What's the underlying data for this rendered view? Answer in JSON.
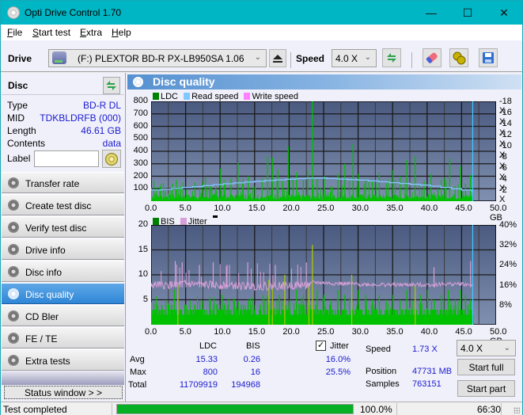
{
  "window": {
    "title": "Opti Drive Control 1.70",
    "controls": {
      "minimize": "—",
      "maximize": "☐",
      "close": "✕"
    }
  },
  "menu": {
    "items": [
      {
        "label": "File",
        "accel": "F",
        "rest": "ile"
      },
      {
        "label": "Start test",
        "accel": "S",
        "rest": "tart test"
      },
      {
        "label": "Extra",
        "accel": "E",
        "rest": "xtra"
      },
      {
        "label": "Help",
        "accel": "H",
        "rest": "elp"
      }
    ]
  },
  "toolbar": {
    "drive_label": "Drive",
    "drive_value": "(F:)  PLEXTOR BD-R  PX-LB950SA 1.06",
    "speed_label": "Speed",
    "speed_value": "4.0 X",
    "icons": [
      "eject-icon",
      "refresh-icon",
      "eraser-icon",
      "options-icon",
      "save-icon"
    ]
  },
  "disc": {
    "header": "Disc",
    "fields": [
      {
        "key": "Type",
        "value": "BD-R DL"
      },
      {
        "key": "MID",
        "value": "TDKBLDRFB (000)"
      },
      {
        "key": "Length",
        "value": "46.61 GB"
      },
      {
        "key": "Contents",
        "value": "data"
      }
    ],
    "label_key": "Label",
    "label_value": ""
  },
  "nav": {
    "items": [
      {
        "label": "Transfer rate",
        "active": false
      },
      {
        "label": "Create test disc",
        "active": false
      },
      {
        "label": "Verify test disc",
        "active": false
      },
      {
        "label": "Drive info",
        "active": false
      },
      {
        "label": "Disc info",
        "active": false
      },
      {
        "label": "Disc quality",
        "active": true
      },
      {
        "label": "CD Bler",
        "active": false
      },
      {
        "label": "FE / TE",
        "active": false
      },
      {
        "label": "Extra tests",
        "active": false
      }
    ],
    "status_window": "Status window > >"
  },
  "panel": {
    "title": "Disc quality"
  },
  "colors": {
    "ldc": "#00c000",
    "bis": "#00c000",
    "read_speed": "#80c8ff",
    "write_speed": "#ff80ff",
    "jitter": "#d8a0d8",
    "legend_ldc": "#008000",
    "legend_bis": "#008000",
    "plot_top": "#4a5a80",
    "plot_bottom": "#8090b0",
    "end_marker": "#40c8ff",
    "progress": "#06b025"
  },
  "chart_data": [
    {
      "type": "bar",
      "title": "LDC / Read speed",
      "legend": [
        "LDC",
        "Read speed",
        "Write speed"
      ],
      "legend_placement": "top-left",
      "xlabel": "GB",
      "x_ticks": [
        "0.0",
        "5.0",
        "10.0",
        "15.0",
        "20.0",
        "25.0",
        "30.0",
        "35.0",
        "40.0",
        "45.0",
        "50.0 GB"
      ],
      "xlim": [
        0,
        50
      ],
      "y_ticks": [
        "800",
        "700",
        "600",
        "500",
        "400",
        "300",
        "200",
        "100"
      ],
      "ylim": [
        0,
        800
      ],
      "y2_ticks": [
        "18 X",
        "16 X",
        "14 X",
        "12 X",
        "10 X",
        "8 X",
        "6 X",
        "4 X",
        "2 X"
      ],
      "y2lim": [
        0,
        18
      ],
      "grid": true,
      "disc_end_gb": 46.61,
      "ldc_spikes": [
        [
          0.5,
          60
        ],
        [
          1.2,
          120
        ],
        [
          2.0,
          80
        ],
        [
          3.0,
          140
        ],
        [
          3.6,
          170
        ],
        [
          4.2,
          110
        ],
        [
          5.0,
          90
        ],
        [
          6.3,
          150
        ],
        [
          7.2,
          70
        ],
        [
          7.8,
          190
        ],
        [
          8.5,
          120
        ],
        [
          9.3,
          110
        ],
        [
          10.0,
          260
        ],
        [
          10.6,
          140
        ],
        [
          11.5,
          180
        ],
        [
          12.5,
          310
        ],
        [
          13.2,
          150
        ],
        [
          14.0,
          200
        ],
        [
          15.0,
          120
        ],
        [
          16.0,
          180
        ],
        [
          16.8,
          360
        ],
        [
          17.5,
          350
        ],
        [
          18.3,
          250
        ],
        [
          19.0,
          160
        ],
        [
          19.8,
          440
        ],
        [
          20.5,
          180
        ],
        [
          21.0,
          230
        ],
        [
          22.0,
          170
        ],
        [
          22.6,
          250
        ],
        [
          23.3,
          800
        ],
        [
          24.0,
          180
        ],
        [
          25.0,
          200
        ],
        [
          26.0,
          120
        ],
        [
          27.0,
          220
        ],
        [
          28.0,
          300
        ],
        [
          29.2,
          460
        ],
        [
          30.0,
          220
        ],
        [
          31.0,
          180
        ],
        [
          32.0,
          160
        ],
        [
          33.0,
          230
        ],
        [
          34.0,
          140
        ],
        [
          35.0,
          250
        ],
        [
          36.0,
          200
        ],
        [
          37.0,
          330
        ],
        [
          38.2,
          360
        ],
        [
          39.5,
          160
        ],
        [
          40.5,
          220
        ],
        [
          41.5,
          100
        ],
        [
          42.5,
          190
        ],
        [
          43.2,
          340
        ],
        [
          44.0,
          120
        ],
        [
          44.8,
          280
        ],
        [
          45.5,
          140
        ],
        [
          46.2,
          210
        ]
      ],
      "ldc_baseline": 30,
      "read_speed": [
        [
          0,
          2.0
        ],
        [
          5,
          2.5
        ],
        [
          10,
          3.1
        ],
        [
          15,
          3.6
        ],
        [
          20,
          4.0
        ],
        [
          23.5,
          4.2
        ],
        [
          25,
          4.1
        ],
        [
          30,
          3.8
        ],
        [
          35,
          3.3
        ],
        [
          40,
          2.8
        ],
        [
          45,
          2.0
        ],
        [
          46.61,
          1.73
        ]
      ]
    },
    {
      "type": "bar",
      "title": "BIS / Jitter",
      "legend": [
        "BIS",
        "Jitter"
      ],
      "legend_placement": "top-left",
      "xlabel": "GB",
      "x_ticks": [
        "0.0",
        "5.0",
        "10.0",
        "15.0",
        "20.0",
        "25.0",
        "30.0",
        "35.0",
        "40.0",
        "45.0",
        "50.0 GB"
      ],
      "xlim": [
        0,
        50
      ],
      "y_ticks": [
        "20",
        "15",
        "10",
        "5"
      ],
      "ylim": [
        0,
        20
      ],
      "y2_ticks": [
        "40%",
        "32%",
        "24%",
        "16%",
        "8%"
      ],
      "y2lim": [
        0,
        40
      ],
      "grid": true,
      "disc_end_gb": 46.61,
      "bis_spikes": [
        [
          0.5,
          3
        ],
        [
          1.5,
          4
        ],
        [
          2.5,
          4
        ],
        [
          3.3,
          7
        ],
        [
          3.8,
          8
        ],
        [
          5.0,
          4
        ],
        [
          6.0,
          3
        ],
        [
          7.0,
          4
        ],
        [
          8.0,
          3
        ],
        [
          8.5,
          5
        ],
        [
          9.5,
          4
        ],
        [
          10.2,
          6
        ],
        [
          11.0,
          4
        ],
        [
          12.0,
          5
        ],
        [
          13.0,
          4
        ],
        [
          14.0,
          5
        ],
        [
          15.0,
          4
        ],
        [
          16.2,
          6
        ],
        [
          17.0,
          9
        ],
        [
          17.5,
          8
        ],
        [
          18.5,
          6
        ],
        [
          19.3,
          10
        ],
        [
          20.0,
          5
        ],
        [
          21.0,
          7
        ],
        [
          22.0,
          6
        ],
        [
          22.8,
          8
        ],
        [
          23.3,
          16
        ],
        [
          24.0,
          7
        ],
        [
          25.0,
          6
        ],
        [
          26.0,
          5
        ],
        [
          27.0,
          7
        ],
        [
          28.0,
          6
        ],
        [
          29.0,
          10
        ],
        [
          30.0,
          7
        ],
        [
          31.0,
          6
        ],
        [
          32.0,
          5
        ],
        [
          33.0,
          6
        ],
        [
          34.0,
          5
        ],
        [
          35.0,
          6
        ],
        [
          36.0,
          5
        ],
        [
          37.0,
          7
        ],
        [
          38.2,
          8
        ],
        [
          39.0,
          6
        ],
        [
          40.0,
          7
        ],
        [
          41.0,
          5
        ],
        [
          42.0,
          6
        ],
        [
          43.0,
          7
        ],
        [
          44.0,
          5
        ],
        [
          44.8,
          7
        ],
        [
          45.5,
          6
        ],
        [
          46.2,
          5
        ]
      ],
      "bis_baseline": 2,
      "jitter_pct": [
        [
          0,
          16.0
        ],
        [
          2,
          15.8
        ],
        [
          5,
          16.4
        ],
        [
          8,
          16.0
        ],
        [
          10,
          15.8
        ],
        [
          13,
          15.6
        ],
        [
          16,
          15.4
        ],
        [
          20,
          15.6
        ],
        [
          23,
          16.0
        ],
        [
          23.5,
          17.0
        ],
        [
          26,
          16.6
        ],
        [
          30,
          16.2
        ],
        [
          35,
          16.0
        ],
        [
          40,
          16.0
        ],
        [
          44,
          16.4
        ],
        [
          46.61,
          16.0
        ]
      ],
      "jitter_spikes": [
        [
          3.5,
          25.5
        ],
        [
          4.5,
          25.0
        ],
        [
          7,
          24
        ],
        [
          9,
          25
        ],
        [
          11,
          24
        ],
        [
          14,
          25
        ],
        [
          18,
          24
        ],
        [
          22.5,
          25
        ],
        [
          41,
          23
        ],
        [
          46.3,
          25.5
        ]
      ]
    }
  ],
  "stats": {
    "col_ldc": "LDC",
    "col_bis": "BIS",
    "jitter_label": "Jitter",
    "jitter_checked": true,
    "rows": [
      {
        "label": "Avg",
        "ldc": "15.33",
        "bis": "0.26",
        "jitter": "16.0%"
      },
      {
        "label": "Max",
        "ldc": "800",
        "bis": "16",
        "jitter": "25.5%"
      },
      {
        "label": "Total",
        "ldc": "11709919",
        "bis": "194968",
        "jitter": ""
      }
    ],
    "speed_label": "Speed",
    "speed_value": "1.73 X",
    "position_label": "Position",
    "position_value": "47731 MB",
    "samples_label": "Samples",
    "samples_value": "763151",
    "speed_select": "4.0 X",
    "start_full": "Start full",
    "start_part": "Start part"
  },
  "statusbar": {
    "text": "Test completed",
    "progress": 1.0,
    "percent": "100.0%",
    "time": "66:30"
  }
}
